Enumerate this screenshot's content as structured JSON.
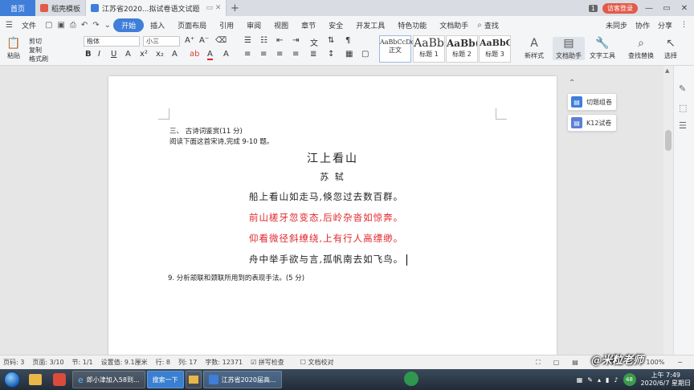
{
  "tabs": {
    "home": "首页",
    "template": "稻壳模板",
    "doc": "江苏省2020...拟试卷语文试题",
    "badge": "1",
    "login": "访客登录"
  },
  "menu": {
    "file": "文件",
    "items": [
      "开始",
      "插入",
      "页面布局",
      "引用",
      "审阅",
      "视图",
      "章节",
      "安全",
      "开发工具",
      "特色功能",
      "文档助手",
      "查找"
    ],
    "right": [
      "未同步",
      "协作",
      "分享"
    ]
  },
  "ribbon": {
    "paste": "粘贴",
    "cut": "剪切",
    "copy": "复制",
    "format_painter": "格式刷",
    "font_name": "楷体",
    "font_size": "小三",
    "styles": [
      {
        "sample": "AaBbCcDd",
        "name": "正文"
      },
      {
        "sample": "AaBb",
        "name": "标题 1"
      },
      {
        "sample": "AaBb(",
        "name": "标题 2"
      },
      {
        "sample": "AaBbC",
        "name": "标题 3"
      }
    ],
    "new_style": "新样式",
    "doc_assistant": "文档助手",
    "text_tool": "文字工具",
    "find_replace": "查找替换",
    "select": "选择"
  },
  "document": {
    "section_heading": "三、 古诗词鉴赏(11 分)",
    "instruction": "阅读下面这首宋诗,完成 9-10 题。",
    "title": "江上看山",
    "author": "苏  轼",
    "lines": [
      {
        "text": "船上看山如走马,倏忽过去数百群。",
        "color": "#222222"
      },
      {
        "text": "前山槎牙忽变态,后岭杂沓如惊奔。",
        "color": "#e0262b"
      },
      {
        "text": "仰看微径斜缭绕,上有行人高缥缈。",
        "color": "#e0262b"
      },
      {
        "text": "舟中举手欲与言,孤帆南去如飞鸟。",
        "color": "#222222"
      }
    ],
    "question": "9. 分析颔联和颈联所用到的表现手法。(5 分)"
  },
  "side_panel": {
    "card1": "切题组卷",
    "card2": "K12试卷"
  },
  "status": {
    "page": "页码: 3",
    "page_of": "页面: 3/10",
    "section": "节: 1/1",
    "setting": "设置值: 9.1厘米",
    "row": "行: 8",
    "col": "列: 17",
    "words": "字数: 12371",
    "spell": "拼写检查",
    "proof": "文档校对",
    "zoom": "100%"
  },
  "taskbar": {
    "btn1": "郎小津加入58到...",
    "btn2": "搜索一下",
    "btn3": "江苏省2020届高...",
    "tray_num": "48",
    "time": "上午 7:49",
    "date": "2020/6/7 星期日"
  },
  "watermark": "@米粒老师"
}
